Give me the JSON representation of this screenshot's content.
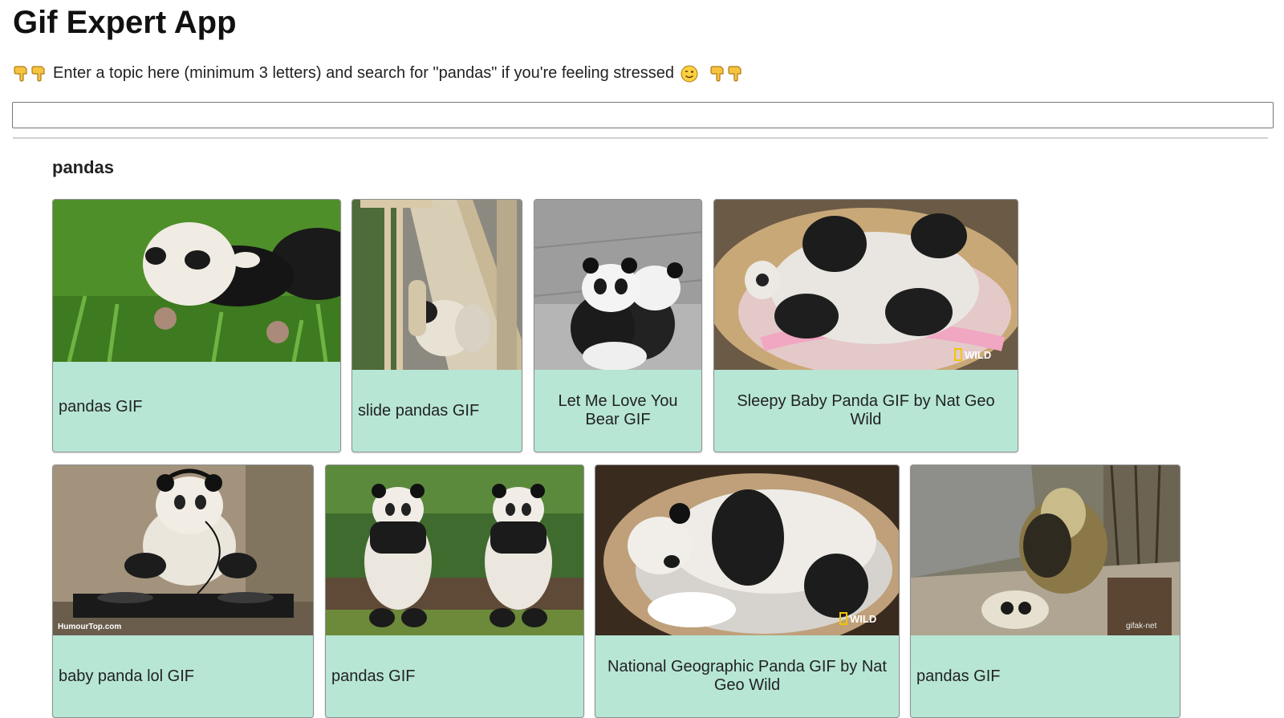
{
  "header": {
    "title": "Gif Expert App"
  },
  "hint": {
    "text": "Enter a topic here (minimum 3 letters) and search for \"pandas\" if you're feeling stressed"
  },
  "search": {
    "value": "",
    "placeholder": ""
  },
  "category": {
    "title": "pandas",
    "gifs": [
      {
        "title": "pandas GIF"
      },
      {
        "title": "slide pandas GIF"
      },
      {
        "title": "Let Me Love You Bear GIF"
      },
      {
        "title": "Sleepy Baby Panda GIF by Nat Geo Wild"
      },
      {
        "title": "baby panda lol GIF"
      },
      {
        "title": "pandas GIF"
      },
      {
        "title": "National Geographic Panda GIF by Nat Geo Wild"
      },
      {
        "title": "pandas GIF"
      }
    ]
  },
  "icons": {
    "pointing": "backhand-index-pointing-down-icon",
    "wink": "winking-face-icon"
  },
  "colors": {
    "card_background": "#b7e6d5",
    "card_border": "#8f8f8f",
    "divider": "#d0d0d0"
  }
}
